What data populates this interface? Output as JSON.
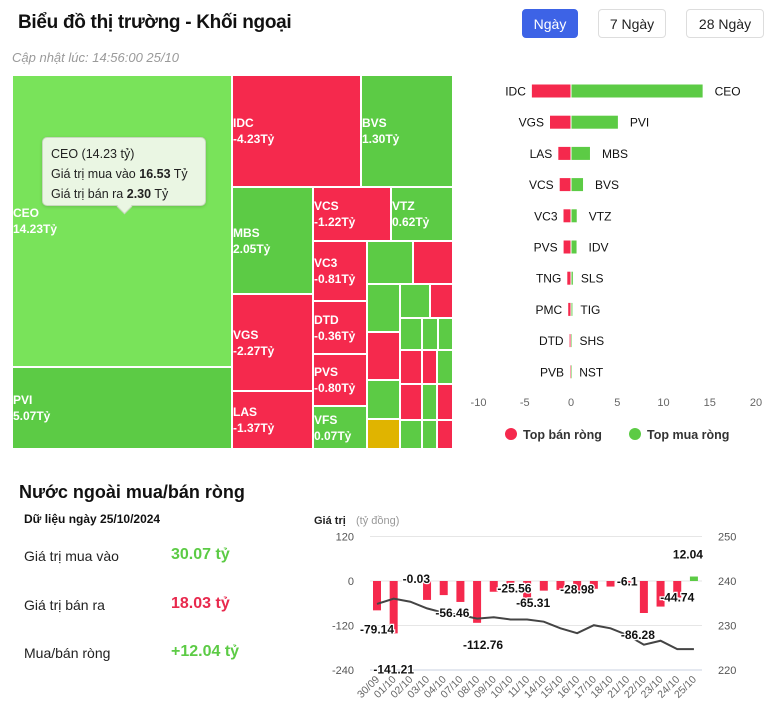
{
  "header": {
    "title": "Biểu đồ thị trường - Khối ngoại",
    "updated": "Cập nhật lúc: 14:56:00 25/10",
    "tabs": [
      {
        "label": "Ngày",
        "active": true
      },
      {
        "label": "7 Ngày",
        "active": false
      },
      {
        "label": "28 Ngày",
        "active": false
      }
    ]
  },
  "colors": {
    "buy": "#5ccb45",
    "buy_light": "#79e35a",
    "sell": "#f5294d",
    "neutral": "#e0b400",
    "accent": "#3d63e6",
    "line": "#444444"
  },
  "treemap": {
    "tiles": [
      {
        "ticker": "CEO",
        "value": "14.23Tỷ",
        "side": "buy"
      },
      {
        "ticker": "PVI",
        "value": "5.07Tỷ",
        "side": "buy"
      },
      {
        "ticker": "IDC",
        "value": "-4.23Tỷ",
        "side": "sell"
      },
      {
        "ticker": "BVS",
        "value": "1.30Tỷ",
        "side": "buy"
      },
      {
        "ticker": "MBS",
        "value": "2.05Tỷ",
        "side": "buy"
      },
      {
        "ticker": "VCS",
        "value": "-1.22Tỷ",
        "side": "sell"
      },
      {
        "ticker": "VTZ",
        "value": "0.62Tỷ",
        "side": "buy"
      },
      {
        "ticker": "VC3",
        "value": "-0.81Tỷ",
        "side": "sell"
      },
      {
        "ticker": "DTD",
        "value": "-0.36Tỷ",
        "side": "sell"
      },
      {
        "ticker": "PVS",
        "value": "-0.80Tỷ",
        "side": "sell"
      },
      {
        "ticker": "VFS",
        "value": "0.07Tỷ",
        "side": "buy"
      },
      {
        "ticker": "VGS",
        "value": "-2.27Tỷ",
        "side": "sell"
      },
      {
        "ticker": "LAS",
        "value": "-1.37Tỷ",
        "side": "sell"
      }
    ],
    "tooltip": {
      "title": "CEO (14.23 tỷ)",
      "buy_label": "Giá trị mua vào",
      "buy_value": "16.53",
      "sell_label": "Giá trị bán ra",
      "sell_value": "2.30",
      "unit": "Tỷ"
    }
  },
  "chart_data": [
    {
      "type": "bar",
      "orientation": "horizontal",
      "xlim": [
        -10,
        20
      ],
      "xticks": [
        "-10",
        "-5",
        "0",
        "5",
        "10",
        "15",
        "20"
      ],
      "legend_position": "bottom",
      "legend": [
        "Top bán ròng",
        "Top mua ròng"
      ],
      "sell": {
        "name": "Top bán ròng",
        "categories": [
          "IDC",
          "VGS",
          "LAS",
          "VCS",
          "VC3",
          "PVS",
          "TNG",
          "PMC",
          "DTD",
          "PVB"
        ],
        "values": [
          -4.23,
          -2.27,
          -1.37,
          -1.22,
          -0.81,
          -0.8,
          -0.4,
          -0.3,
          -0.15,
          -0.1
        ]
      },
      "buy": {
        "name": "Top mua ròng",
        "categories": [
          "CEO",
          "PVI",
          "MBS",
          "BVS",
          "VTZ",
          "IDV",
          "SLS",
          "TIG",
          "SHS",
          "NST"
        ],
        "values": [
          14.23,
          5.07,
          2.05,
          1.3,
          0.62,
          0.6,
          0.2,
          0.15,
          0.05,
          0.03
        ]
      }
    },
    {
      "type": "bar+line",
      "ylabel": "Giá trị",
      "ylabel_unit": "(tỷ đồng)",
      "ylim": [
        -240,
        120
      ],
      "yticks": [
        "120",
        "0",
        "-120",
        "-240"
      ],
      "y2lim": [
        220,
        250
      ],
      "y2ticks": [
        "250",
        "240",
        "230",
        "220"
      ],
      "grid": true,
      "categories": [
        "30/09",
        "01/10",
        "02/10",
        "03/10",
        "04/10",
        "07/10",
        "08/10",
        "09/10",
        "10/10",
        "11/10",
        "14/10",
        "15/10",
        "16/10",
        "17/10",
        "18/10",
        "21/10",
        "22/10",
        "23/10",
        "24/10",
        "25/10"
      ],
      "values": [
        -79.14,
        -141.21,
        -0.03,
        -51,
        -38,
        -56.46,
        -112.76,
        -29,
        -25.56,
        -65.31,
        -26,
        -24,
        -28.98,
        -21,
        -15,
        -6.1,
        -86.28,
        -69,
        -44.74,
        12.04
      ],
      "data_labels": [
        "-79.14",
        "-141.21",
        "-0.03",
        "",
        "",
        "-56.46",
        "-112.76",
        "",
        "-25.56",
        "-65.31",
        "",
        "",
        "-28.98",
        "",
        "",
        "-6.1",
        "-86.28",
        "",
        "-44.74",
        "12.04"
      ],
      "line_values": [
        234.9,
        236.1,
        235.4,
        233.9,
        232.9,
        232.4,
        231.6,
        231.9,
        231.4,
        231.4,
        230.9,
        229.4,
        228.3,
        230.1,
        229.4,
        227.9,
        225.7,
        226.6,
        224.7,
        224.7
      ]
    }
  ],
  "summary": {
    "title": "Nước ngoài mua/bán ròng",
    "date": "Dữ liệu ngày 25/10/2024",
    "rows": [
      {
        "label": "Giá trị mua vào",
        "value": "30.07 tỷ",
        "tone": "buy"
      },
      {
        "label": "Giá trị bán ra",
        "value": "18.03 tỷ",
        "tone": "sell"
      },
      {
        "label": "Mua/bán ròng",
        "value": "+12.04 tỷ",
        "tone": "buy"
      }
    ]
  }
}
